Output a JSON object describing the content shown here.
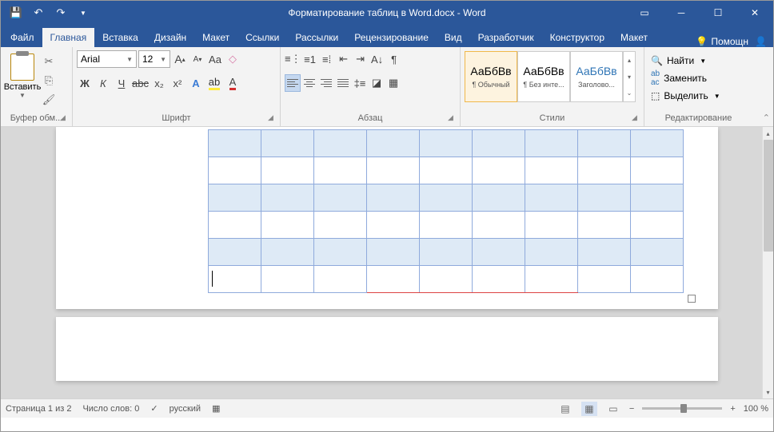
{
  "title": "Форматирование таблиц в Word.docx - Word",
  "qat": {
    "save": "💾",
    "undo": "↶",
    "redo": "↷"
  },
  "tabs": [
    "Файл",
    "Главная",
    "Вставка",
    "Дизайн",
    "Макет",
    "Ссылки",
    "Рассылки",
    "Рецензирование",
    "Вид",
    "Разработчик",
    "Конструктор",
    "Макет"
  ],
  "active_tab": 1,
  "help_label": "Помощн",
  "ribbon": {
    "clipboard": {
      "paste": "Вставить",
      "group": "Буфер обм..."
    },
    "font": {
      "name": "Arial",
      "size": "12",
      "group": "Шрифт",
      "grow": "A",
      "shrink": "A",
      "case": "Aa",
      "clear": "⌫",
      "bold": "Ж",
      "italic": "К",
      "underline": "Ч",
      "strike": "abc",
      "sub": "x₂",
      "sup": "x²",
      "effects": "A",
      "highlight": "✎",
      "color": "A"
    },
    "para": {
      "group": "Абзац",
      "bullets": "⋮≡",
      "numbers": "1≡",
      "multi": "⋮⋮",
      "dec": "⇤",
      "inc": "⇥",
      "sort": "A↓",
      "show": "¶",
      "spacing": "↕≡",
      "fill": "◪",
      "borders": "▦"
    },
    "styles": {
      "group": "Стили",
      "items": [
        {
          "prev": "АаБбВв",
          "name": "¶ Обычный"
        },
        {
          "prev": "АаБбВв",
          "name": "¶ Без инте..."
        },
        {
          "prev": "АаБбВв",
          "name": "Заголово..."
        }
      ]
    },
    "editing": {
      "group": "Редактирование",
      "find": "Найти",
      "replace": "Заменить",
      "select": "Выделить"
    }
  },
  "statusbar": {
    "page": "Страница 1 из 2",
    "words": "Число слов: 0",
    "lang": "русский",
    "zoom": "100 %"
  }
}
